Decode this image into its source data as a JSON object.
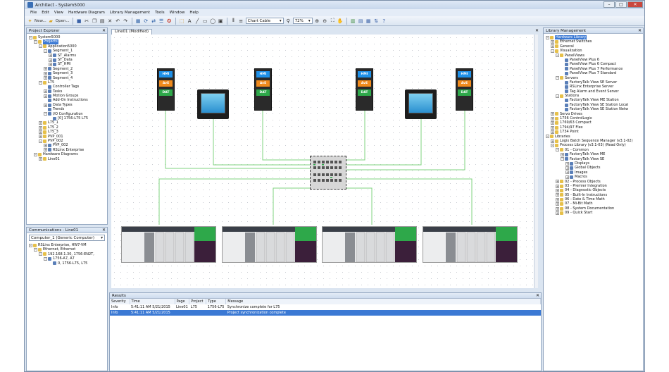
{
  "window": {
    "title": "Architect - System5000",
    "controls": {
      "minimize": "–",
      "maximize": "□",
      "close": "✕"
    }
  },
  "menu": [
    "File",
    "Edit",
    "View",
    "Hardware Diagram",
    "Library Management",
    "Tools",
    "Window",
    "Help"
  ],
  "toolbar": {
    "new_label": "New...",
    "open_label": "Open...",
    "chart_combo": "Chart Cable",
    "zoom_value": "72%"
  },
  "project_explorer": {
    "title": "Project Explorer",
    "nodes": [
      {
        "label": "System5000",
        "depth": 0,
        "exp": "–"
      },
      {
        "label": "Projects",
        "depth": 1,
        "exp": "–",
        "selected": true
      },
      {
        "label": "Application5000",
        "depth": 2,
        "exp": "–"
      },
      {
        "label": "Segment_1",
        "depth": 3,
        "exp": "–"
      },
      {
        "label": "ST_Alarms",
        "depth": 4,
        "exp": "+"
      },
      {
        "label": "ST_Data",
        "depth": 4,
        "exp": "+"
      },
      {
        "label": "ST_HMI",
        "depth": 4,
        "exp": "+"
      },
      {
        "label": "Segment_2",
        "depth": 3,
        "exp": "+"
      },
      {
        "label": "Segment_3",
        "depth": 3,
        "exp": "+"
      },
      {
        "label": "Segment_4",
        "depth": 3,
        "exp": "+"
      },
      {
        "label": "L75",
        "depth": 2,
        "exp": "–"
      },
      {
        "label": "Controller Tags",
        "depth": 3,
        "exp": ""
      },
      {
        "label": "Tasks",
        "depth": 3,
        "exp": "+"
      },
      {
        "label": "Motion Groups",
        "depth": 3,
        "exp": "+"
      },
      {
        "label": "Add-On Instructions",
        "depth": 3,
        "exp": ""
      },
      {
        "label": "Data Types",
        "depth": 3,
        "exp": "+"
      },
      {
        "label": "Trends",
        "depth": 3,
        "exp": ""
      },
      {
        "label": "I/O Configuration",
        "depth": 3,
        "exp": "–"
      },
      {
        "label": "[0] 1756-L75 L75",
        "depth": 4,
        "exp": ""
      },
      {
        "label": "L75_1",
        "depth": 2,
        "exp": "+"
      },
      {
        "label": "L75_2",
        "depth": 2,
        "exp": "+"
      },
      {
        "label": "L75_3",
        "depth": 2,
        "exp": "+"
      },
      {
        "label": "PVP_001",
        "depth": 2,
        "exp": "+"
      },
      {
        "label": "PVP_002",
        "depth": 2,
        "exp": "–"
      },
      {
        "label": "PVP_002",
        "depth": 3,
        "exp": "+"
      },
      {
        "label": "RSLinx Enterprise",
        "depth": 3,
        "exp": "+"
      },
      {
        "label": "Hardware Diagrams",
        "depth": 1,
        "exp": "–"
      },
      {
        "label": "Line01",
        "depth": 2,
        "exp": "+"
      }
    ]
  },
  "communications": {
    "title": "Communications - Line01",
    "combo": "Computer_1 (Generic Computer)",
    "nodes": [
      {
        "label": "RSLinx Enterprise, HW7-VM",
        "depth": 0,
        "exp": "–"
      },
      {
        "label": "Ethernet, Ethernet",
        "depth": 1,
        "exp": "–"
      },
      {
        "label": "192.168.1.30, 1756-EN2T,",
        "depth": 2,
        "exp": "–"
      },
      {
        "label": "1756-A7, A7",
        "depth": 3,
        "exp": "–"
      },
      {
        "label": "0, 1756-L75, L75",
        "depth": 4,
        "exp": ""
      }
    ]
  },
  "diagram": {
    "tab_label": "Line01 (Modified)",
    "hmi_labels": {
      "top": "HMI",
      "mid": "AvE",
      "bot": "DAT"
    },
    "colors": {
      "wire": "#7fd37f",
      "hmi_top": "#1e90e8",
      "hmi_mid": "#f08a1c",
      "hmi_bot": "#2ea84a"
    }
  },
  "results": {
    "title": "Results",
    "columns": [
      "Severity",
      "Time",
      "Page",
      "Project",
      "Type",
      "Message"
    ],
    "rows": [
      {
        "severity": "Info",
        "time": "5:41:11 AM 5/21/2015",
        "page": "Line01",
        "project": "L75",
        "type": "1756-L75",
        "message": "Synchronize complete for L75"
      },
      {
        "severity": "Info",
        "time": "5:41:11 AM 5/21/2015",
        "page": "",
        "project": "",
        "type": "",
        "message": "Project synchronization complete"
      }
    ]
  },
  "library": {
    "title": "Library Management",
    "nodes": [
      {
        "label": "Hardware Library",
        "depth": 0,
        "exp": "–",
        "selected": true
      },
      {
        "label": "Ethernet Switches",
        "depth": 1,
        "exp": "+"
      },
      {
        "label": "General",
        "depth": 1,
        "exp": "+"
      },
      {
        "label": "Visualization",
        "depth": 1,
        "exp": "–"
      },
      {
        "label": "PanelViews",
        "depth": 2,
        "exp": "–"
      },
      {
        "label": "PanelView Plus 6",
        "depth": 3,
        "exp": ""
      },
      {
        "label": "PanelView Plus 6 Compact",
        "depth": 3,
        "exp": ""
      },
      {
        "label": "PanelView Plus 7 Performance",
        "depth": 3,
        "exp": ""
      },
      {
        "label": "PanelView Plus 7 Standard",
        "depth": 3,
        "exp": ""
      },
      {
        "label": "Servers",
        "depth": 2,
        "exp": "–"
      },
      {
        "label": "FactoryTalk View SE Server",
        "depth": 3,
        "exp": ""
      },
      {
        "label": "RSLinx Enterprise Server",
        "depth": 3,
        "exp": ""
      },
      {
        "label": "Tag Alarm and Event Server",
        "depth": 3,
        "exp": ""
      },
      {
        "label": "Stations",
        "depth": 2,
        "exp": "–"
      },
      {
        "label": "FactoryTalk View ME Station",
        "depth": 3,
        "exp": ""
      },
      {
        "label": "FactoryTalk View SE Station Local",
        "depth": 3,
        "exp": ""
      },
      {
        "label": "FactoryTalk View SE Station Netw",
        "depth": 3,
        "exp": ""
      },
      {
        "label": "Servo Drives",
        "depth": 1,
        "exp": "+"
      },
      {
        "label": "1756 ControlLogix",
        "depth": 1,
        "exp": "+"
      },
      {
        "label": "1769/63 Compact",
        "depth": 1,
        "exp": "+"
      },
      {
        "label": "1794/97 Flex",
        "depth": 1,
        "exp": "+"
      },
      {
        "label": "1734 Point",
        "depth": 1,
        "exp": "+"
      },
      {
        "label": "Libraries",
        "depth": 0,
        "exp": "–"
      },
      {
        "label": "Logix Batch Sequence Manager (v3.1-02)",
        "depth": 1,
        "exp": "+"
      },
      {
        "label": "Process Library (v3.1-03) (Read Only)",
        "depth": 1,
        "exp": "–"
      },
      {
        "label": "01 - Common",
        "depth": 2,
        "exp": "–"
      },
      {
        "label": "FactoryTalk View ME",
        "depth": 3,
        "exp": "+"
      },
      {
        "label": "FactoryTalk View SE",
        "depth": 3,
        "exp": "–"
      },
      {
        "label": "Displays",
        "depth": 4,
        "exp": "+"
      },
      {
        "label": "Global Objects",
        "depth": 4,
        "exp": "+"
      },
      {
        "label": "Images",
        "depth": 4,
        "exp": "+"
      },
      {
        "label": "Macros",
        "depth": 4,
        "exp": "+"
      },
      {
        "label": "02 - Process Objects",
        "depth": 2,
        "exp": "+"
      },
      {
        "label": "03 - Premier Integration",
        "depth": 2,
        "exp": "+"
      },
      {
        "label": "04 - Diagnostic Objects",
        "depth": 2,
        "exp": "+"
      },
      {
        "label": "05 - Built-In Instructions",
        "depth": 2,
        "exp": "+"
      },
      {
        "label": "06 - Date & Time Math",
        "depth": 2,
        "exp": "+"
      },
      {
        "label": "07 - Mi-Bit Math",
        "depth": 2,
        "exp": "+"
      },
      {
        "label": "08 - System Documentation",
        "depth": 2,
        "exp": "+"
      },
      {
        "label": "09 - Quick Start",
        "depth": 2,
        "exp": "+"
      }
    ]
  }
}
